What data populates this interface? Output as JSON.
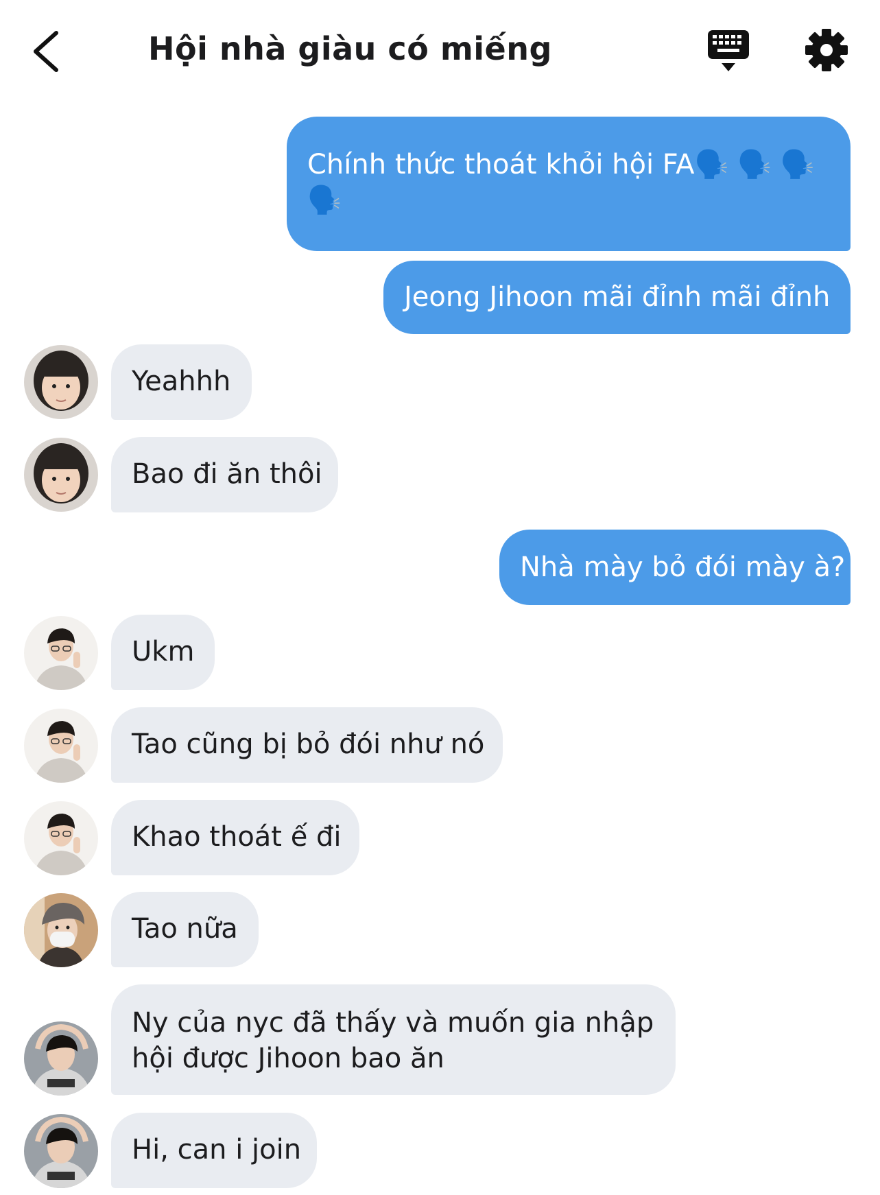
{
  "header": {
    "title": "Hội nhà giàu có miếng",
    "back_icon": "chevron-left-icon",
    "keyboard_icon": "keyboard-icon",
    "settings_icon": "gear-icon"
  },
  "colors": {
    "outgoing_bubble": "#4c9be8",
    "incoming_bubble": "#e9ecf1",
    "text_dark": "#1c1c1e"
  },
  "messages": [
    {
      "direction": "out",
      "text": "Chính thức thoát khỏi hội FA🗣️ 🗣️ 🗣️ 🗣️"
    },
    {
      "direction": "out",
      "text": "Jeong Jihoon mãi đỉnh mãi đỉnh"
    },
    {
      "direction": "in",
      "avatar": "user-a",
      "text": "Yeahhh"
    },
    {
      "direction": "in",
      "avatar": "user-a",
      "text": "Bao đi ăn thôi"
    },
    {
      "direction": "out",
      "text": "Nhà mày bỏ đói mày à?"
    },
    {
      "direction": "in",
      "avatar": "user-b",
      "text": "Ukm"
    },
    {
      "direction": "in",
      "avatar": "user-b",
      "text": "Tao cũng bị bỏ đói như nó"
    },
    {
      "direction": "in",
      "avatar": "user-b",
      "text": "Khao thoát ế đi"
    },
    {
      "direction": "in",
      "avatar": "user-c",
      "text": "Tao nữa"
    },
    {
      "direction": "in",
      "avatar": "user-d",
      "text": "Ny của nyc đã thấy và muốn gia nhập hội được Jihoon bao ăn"
    },
    {
      "direction": "in",
      "avatar": "user-d",
      "text": "Hi, can i join"
    }
  ]
}
